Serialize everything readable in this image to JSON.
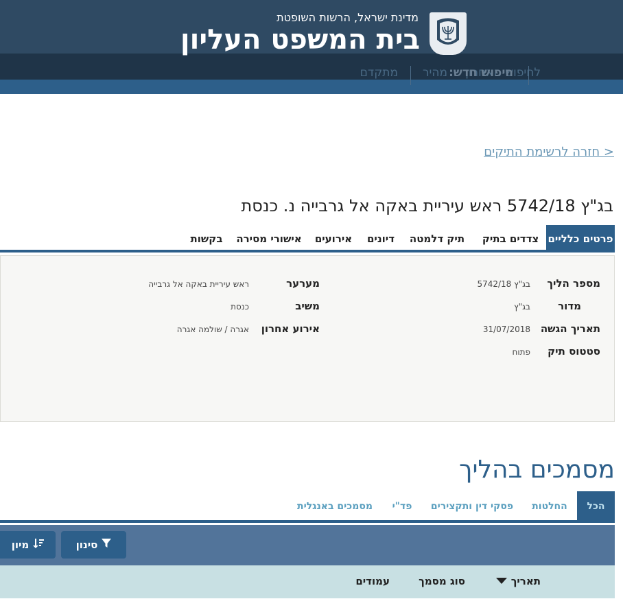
{
  "header": {
    "gov_name": "מדינת ישראל, הרשות השופטת",
    "court_name": "בית המשפט העליון",
    "last_search": "לחיפוש האחרון",
    "new_search": "חיפוש חדש:",
    "quick": "מהיר",
    "advanced": "מתקדם"
  },
  "back_link": "< חזרה לרשימת התיקים",
  "case_title": "בג\"ץ 5742/18 ראש עיריית באקה אל גרבייה נ. כנסת",
  "tabs": [
    "פרטים כלליים",
    "צדדים בתיק",
    "תיק דלמטה",
    "דיונים",
    "אירועים",
    "אישורי מסירה",
    "בקשות"
  ],
  "details": {
    "right": [
      {
        "label": "מספר הליך",
        "value": "בג\"ץ 5742/18"
      },
      {
        "label": "מדור",
        "value": "בג\"ץ"
      },
      {
        "label": "תאריך הגשה",
        "value": "31/07/2018"
      },
      {
        "label": "סטטוס תיק",
        "value": "פתוח"
      }
    ],
    "left": [
      {
        "label": "מערער",
        "value": "ראש עיריית באקה אל גרבייה"
      },
      {
        "label": "משיב",
        "value": "כנסת"
      },
      {
        "label": "אירוע אחרון",
        "value": "אגרה / שולמה אגרה"
      }
    ]
  },
  "documents": {
    "title": "מסמכים בהליך",
    "tabs": [
      "הכל",
      "החלטות",
      "פסקי דין ותקצירים",
      "פד\"י",
      "מסמכים באנגלית"
    ],
    "filter_label": "סינון",
    "sort_label": "מיון",
    "columns": [
      "תאריך",
      "סוג מסמך",
      "עמודים"
    ]
  }
}
